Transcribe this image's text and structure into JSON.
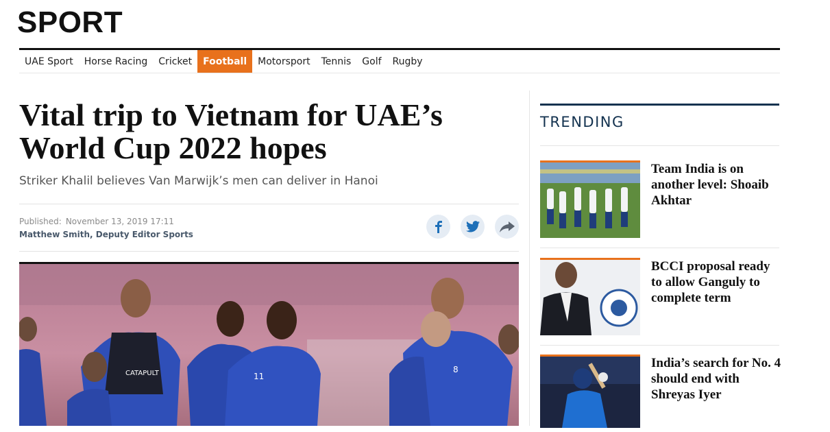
{
  "section": {
    "title": "SPORT"
  },
  "nav": {
    "items": [
      {
        "label": "UAE Sport"
      },
      {
        "label": "Horse Racing"
      },
      {
        "label": "Cricket"
      },
      {
        "label": "Football"
      },
      {
        "label": "Motorsport"
      },
      {
        "label": "Tennis"
      },
      {
        "label": "Golf"
      },
      {
        "label": "Rugby"
      }
    ],
    "active": "Football"
  },
  "article": {
    "headline": "Vital trip to Vietnam for UAE’s World Cup 2022 hopes",
    "subhead": "Striker Khalil believes Van Marwijk’s men can deliver in Hanoi",
    "published_label": "Published:",
    "published_date": "November 13, 2019 17:11",
    "author": "Matthew Smith, Deputy Editor Sports",
    "share_icons": [
      "facebook-icon",
      "twitter-icon",
      "share-icon"
    ]
  },
  "trending": {
    "title": "TRENDING",
    "items": [
      {
        "title": "Team India is on another level: Shoaib Akhtar"
      },
      {
        "title": "BCCI proposal ready to allow Ganguly to complete term"
      },
      {
        "title": "India’s search for No. 4 should end with Shreyas Iyer"
      }
    ]
  },
  "colors": {
    "accent_orange": "#e8711c",
    "trending_navy": "#13324f",
    "share_bg": "#e5ecf4",
    "share_icon": "#1d6fb8"
  }
}
